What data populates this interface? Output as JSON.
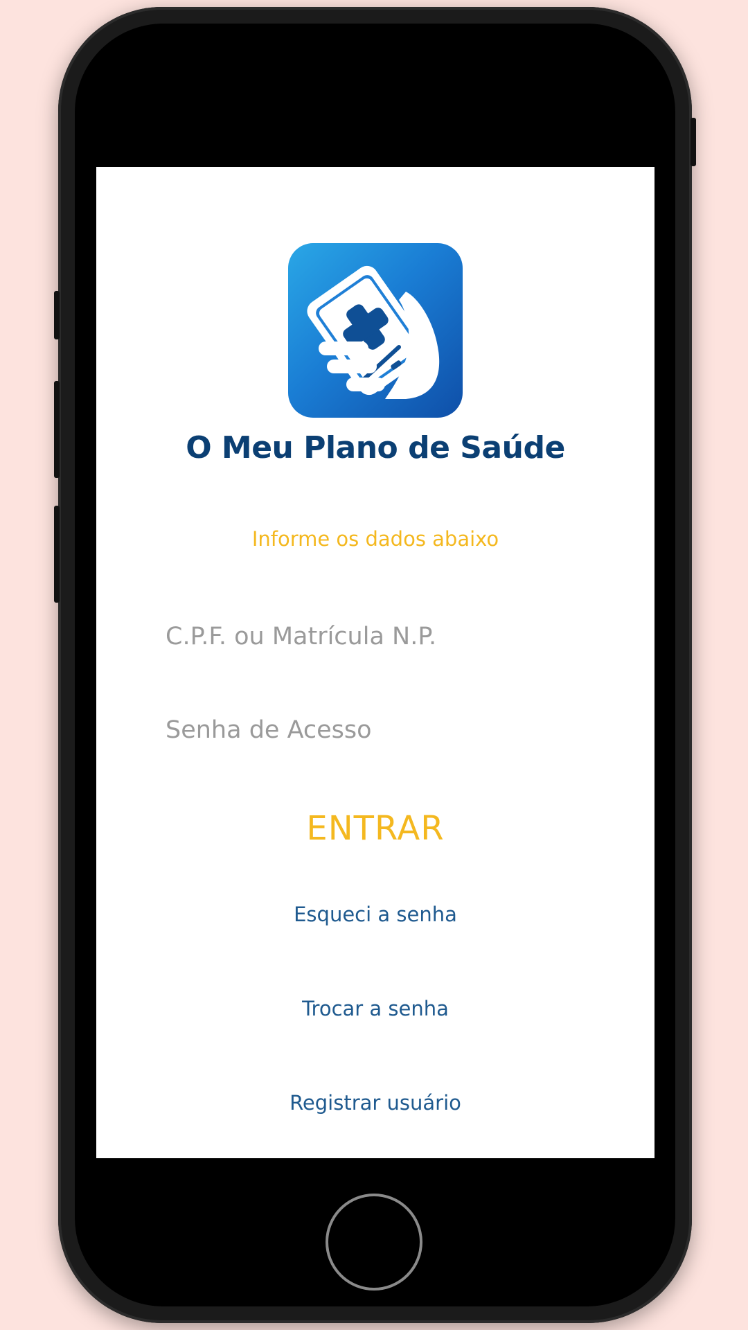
{
  "app": {
    "title": "O Meu Plano de Saúde",
    "brand_colors": {
      "primary": "#0b3f73",
      "accent": "#f4b81f",
      "link": "#1f5a8f",
      "background": "#fde3de"
    }
  },
  "login": {
    "instruction": "Informe os dados abaixo",
    "cpf_placeholder": "C.P.F. ou Matrícula N.P.",
    "password_placeholder": "Senha de Acesso",
    "submit_label": "ENTRAR"
  },
  "links": {
    "forgot_password": "Esqueci a senha",
    "change_password": "Trocar a senha",
    "register_user": "Registrar usuário"
  },
  "icons": {
    "logo": "hand-holding-phone-medical-cross-icon",
    "home_button": "home-button"
  }
}
